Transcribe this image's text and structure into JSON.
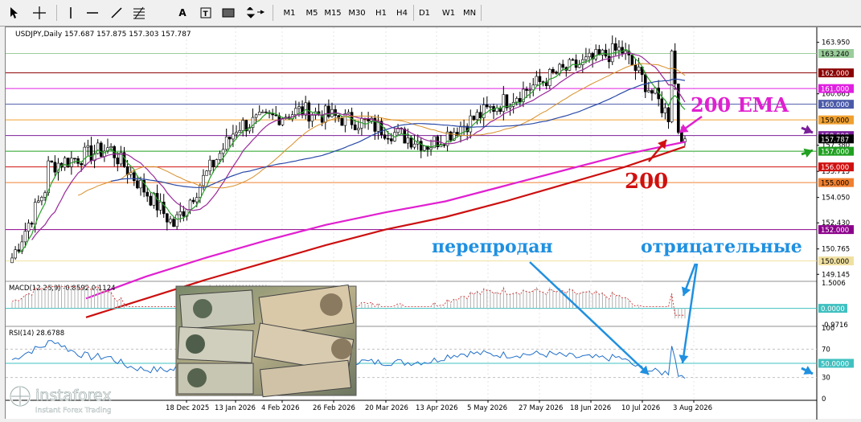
{
  "toolbar": {
    "timeframes": [
      "M1",
      "M5",
      "M15",
      "M30",
      "H1",
      "H4",
      "D1",
      "W1",
      "MN"
    ],
    "icons": [
      "cursor-icon",
      "crosshair-icon",
      "vertical-line-icon",
      "horizontal-line-icon",
      "trendline-icon",
      "fibonacci-icon",
      "text-icon",
      "label-icon",
      "rectangle-icon",
      "arrows-icon"
    ]
  },
  "header": {
    "symbol_line": "USDJPY,Daily  157.687 157.875 157.303 157.787"
  },
  "price_axis": {
    "ticks": [
      "163.950",
      "160.665",
      "157.380",
      "155.715",
      "154.050",
      "152.430",
      "150.765",
      "149.145"
    ],
    "levels": [
      {
        "text": "163.240",
        "color": "#9acd9a"
      },
      {
        "text": "162.000",
        "color": "#8b0000"
      },
      {
        "text": "161.000",
        "color": "#e020e0"
      },
      {
        "text": "160.000",
        "color": "#4b5aa8"
      },
      {
        "text": "159.000",
        "color": "#f0a030"
      },
      {
        "text": "158.000",
        "color": "#7a1f9a"
      },
      {
        "text": "157.787",
        "color": "#000000"
      },
      {
        "text": "157.000",
        "color": "#20a020"
      },
      {
        "text": "156.000",
        "color": "#d01010"
      },
      {
        "text": "155.000",
        "color": "#f08030"
      },
      {
        "text": "152.000",
        "color": "#8b008b"
      },
      {
        "text": "150.000",
        "color": "#f0e0a0"
      }
    ]
  },
  "macd": {
    "label": "MACD(12,26,9) -0.8592 0.1124",
    "ticks": [
      "1.5006",
      "-0.9716"
    ],
    "zero_label": "0.0000"
  },
  "rsi": {
    "label": "RSI(14) 28.6788",
    "ticks": [
      "100",
      "70",
      "30",
      "0"
    ],
    "level_label": "50.0000"
  },
  "date_axis": {
    "labels": [
      "18 Dec 2025",
      "13 Jan 2026",
      "4 Feb 2026",
      "26 Feb 2026",
      "20 Mar 2026",
      "13 Apr 2026",
      "5 May 2026",
      "27 May 2026",
      "18 Jun 2026",
      "10 Jul 2026",
      "3 Aug 2026"
    ]
  },
  "annotations": {
    "ema_label": "200 EMA",
    "sma_label": "200",
    "oversold_label": "перепродан",
    "negative_label": "отрицательные"
  },
  "logo": {
    "brand": "instaforex",
    "tagline": "Instant Forex Trading"
  },
  "chart_data": {
    "type": "line",
    "symbol": "USDJPY",
    "timeframe": "Daily",
    "ohlc_last": {
      "open": 157.687,
      "high": 157.875,
      "low": 157.303,
      "close": 157.787
    },
    "x": [
      "18 Dec 2025",
      "13 Jan 2026",
      "4 Feb 2026",
      "26 Feb 2026",
      "20 Mar 2026",
      "13 Apr 2026",
      "5 May 2026",
      "27 May 2026",
      "18 Jun 2026",
      "10 Jul 2026",
      "3 Aug 2026"
    ],
    "series": [
      {
        "values": [
          156.0,
          157.2,
          152.3,
          158.6,
          159.6,
          158.8,
          157.4,
          159.8,
          162.0,
          163.5,
          157.8
        ]
      },
      {
        "values": [
          146.4,
          147.6,
          148.8,
          149.9,
          151.0,
          152.0,
          152.8,
          153.8,
          154.9,
          156.0,
          157.3
        ]
      },
      {
        "values": [
          147.6,
          149.0,
          150.2,
          151.3,
          152.3,
          153.1,
          153.8,
          154.8,
          155.8,
          156.8,
          157.6
        ]
      }
    ],
    "horizontal_levels": [
      163.24,
      162.0,
      161.0,
      160.0,
      159.0,
      158.0,
      157.0,
      156.0,
      155.0,
      152.0,
      150.0
    ],
    "ylim": [
      148.8,
      164.6
    ],
    "macd": {
      "value": -0.8592,
      "signal": 0.1124,
      "ylim": [
        -0.9716,
        1.5006
      ]
    },
    "rsi": {
      "value": 28.6788,
      "levels": [
        70,
        50,
        30
      ],
      "ylim": [
        0,
        100
      ]
    }
  }
}
